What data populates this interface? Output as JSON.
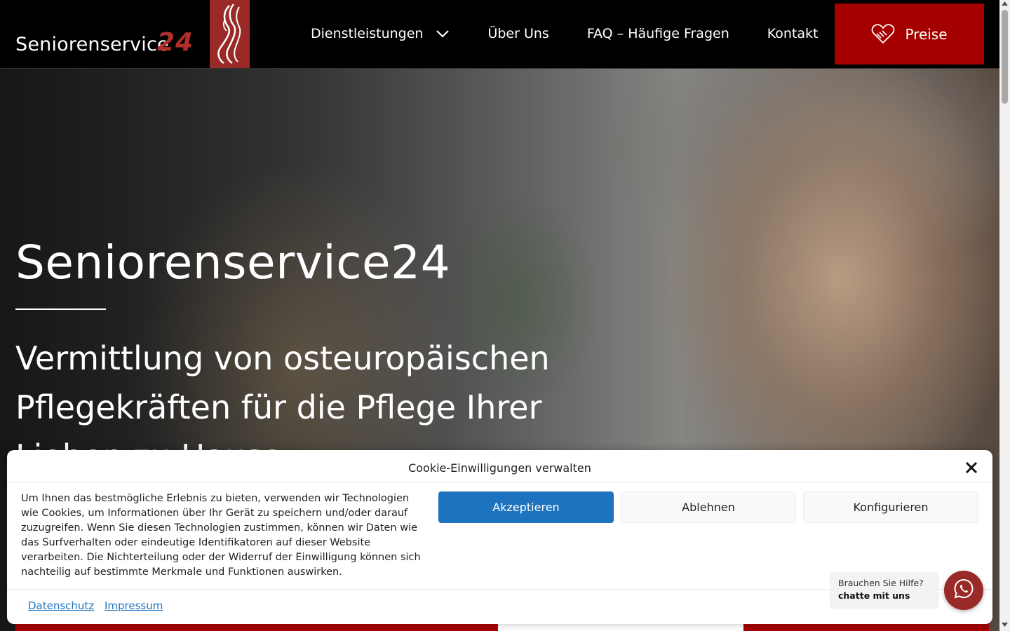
{
  "header": {
    "logo_text": "Seniorenservice",
    "logo_number": "24",
    "nav": [
      {
        "label": "Dienstleistungen",
        "has_dropdown": true
      },
      {
        "label": "Über Uns"
      },
      {
        "label": "FAQ – Häufige Fragen"
      },
      {
        "label": "Kontakt"
      }
    ],
    "cta_label": "Preise"
  },
  "hero": {
    "title": "Seniorenservice24",
    "subtitle": "Vermittlung von osteuropäischen Pflegekräften für die Pflege Ihrer Lieben zu Hause"
  },
  "cookie": {
    "title": "Cookie-Einwilligungen verwalten",
    "text": "Um Ihnen das bestmögliche Erlebnis zu bieten, verwenden wir Technologien wie Cookies, um Informationen über Ihr Gerät zu speichern und/oder darauf zuzugreifen. Wenn Sie diesen Technologien zustimmen, können wir Daten wie das Surfverhalten oder eindeutige Identifikatoren auf dieser Website verarbeiten. Die Nichterteilung oder der Widerruf der Einwilligung können sich nachteilig auf bestimmte Merkmale und Funktionen auswirken.",
    "accept_label": "Akzeptieren",
    "deny_label": "Ablehnen",
    "configure_label": "Konfigurieren",
    "links": [
      "Datenschutz",
      "Impressum"
    ]
  },
  "chat": {
    "line1": "Brauchen Sie Hilfe?",
    "line2": "chatte mit uns",
    "icon": "whatsapp-icon"
  },
  "colors": {
    "brand_red": "#a50000",
    "logo_red": "#9a2a27",
    "accept_blue": "#1e73be"
  }
}
